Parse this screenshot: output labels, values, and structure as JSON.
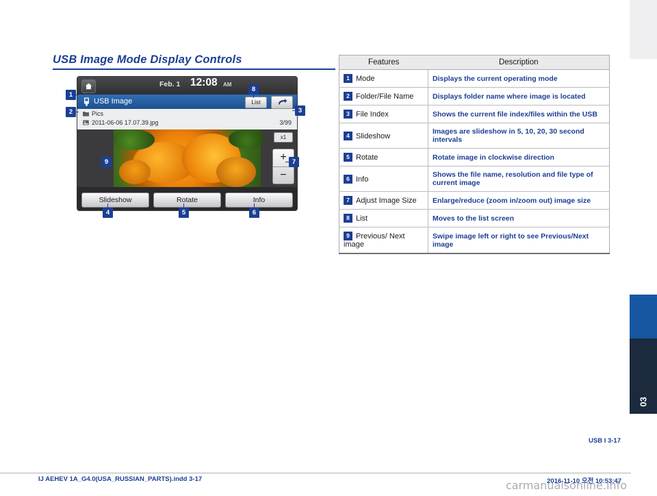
{
  "heading": "USB Image Mode Display Controls",
  "device": {
    "date": "Feb.  1",
    "time": "12:08",
    "ampm": "AM",
    "title": "USB Image",
    "list_button": "List",
    "folder": "Pics",
    "file": "2011-06-06 17.07.39.jpg",
    "index": "3/99",
    "zoom_level": "x1",
    "zoom_in": "+",
    "zoom_out": "−",
    "buttons": [
      "Slideshow",
      "Rotate",
      "Info"
    ]
  },
  "callouts": [
    "1",
    "2",
    "3",
    "4",
    "5",
    "6",
    "7",
    "8",
    "9"
  ],
  "table": {
    "headers": [
      "Features",
      "Description"
    ],
    "rows": [
      {
        "num": "1",
        "feature": "Mode",
        "desc": "Displays the current operating mode"
      },
      {
        "num": "2",
        "feature": "Folder/File Name",
        "desc": "Displays folder name where image is located"
      },
      {
        "num": "3",
        "feature": "File Index",
        "desc": "Shows the current file index/files within the USB"
      },
      {
        "num": "4",
        "feature": "Slideshow",
        "desc": "Images are slideshow in 5, 10, 20, 30 second intervals"
      },
      {
        "num": "5",
        "feature": "Rotate",
        "desc": "Rotate image in clockwise direction"
      },
      {
        "num": "6",
        "feature": "Info",
        "desc": "Shows the file name, resolution and file type of current image"
      },
      {
        "num": "7",
        "feature": "Adjust Image Size",
        "desc": "Enlarge/reduce (zoom in/zoom out) image size"
      },
      {
        "num": "8",
        "feature": "List",
        "desc": "Moves to the list screen"
      },
      {
        "num": "9",
        "feature": "Previous/ Next image",
        "desc": "Swipe image left or right to see Previous/Next image"
      }
    ]
  },
  "chapter": "03",
  "page_label": "USB I 3-17",
  "footer_left": "IJ AEHEV 1A_G4.0(USA_RUSSIAN_PARTS).indd   3-17",
  "footer_right": "2016-11-10   오전 10:53:47",
  "watermark": "carmanualsonline.info"
}
